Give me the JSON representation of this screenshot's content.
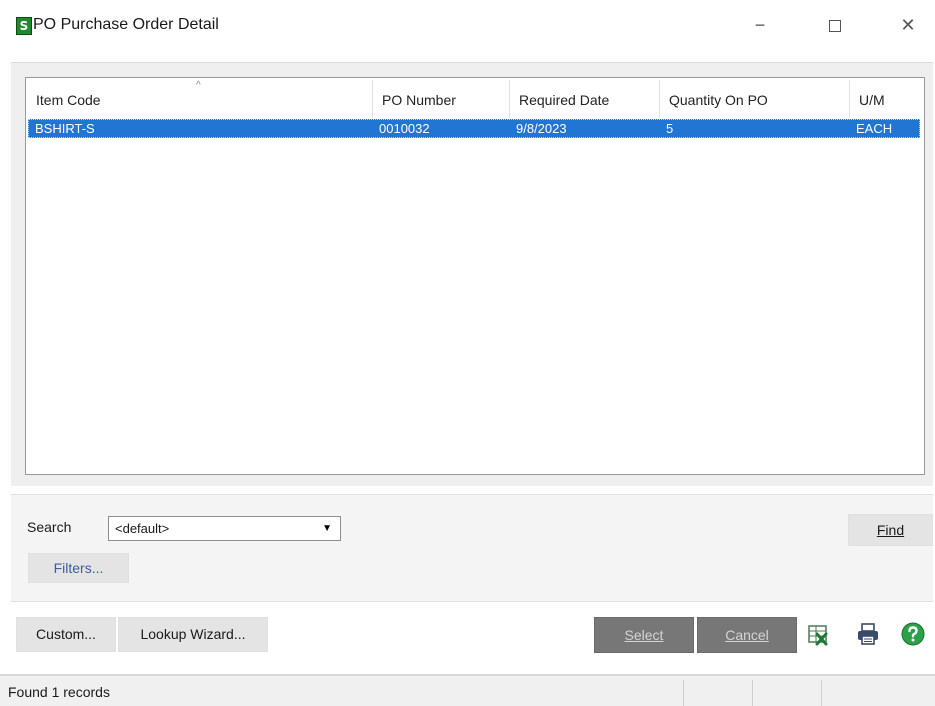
{
  "window": {
    "app_icon_letter": "S",
    "title": "PO Purchase Order Detail",
    "minimize_glyph": "−",
    "close_glyph": "✕"
  },
  "grid": {
    "sort_glyph": "^",
    "columns": [
      "Item Code",
      "PO Number",
      "Required Date",
      "Quantity On PO",
      "U/M"
    ],
    "rows": [
      [
        "BSHIRT-S",
        "0010032",
        "9/8/2023",
        "5",
        "EACH"
      ]
    ]
  },
  "search": {
    "label": "Search",
    "selected": "<default>",
    "find_label": "Find",
    "filters_label": "Filters..."
  },
  "toolbar": {
    "custom_label": "Custom...",
    "wizard_label": "Lookup Wizard...",
    "select_label": "Select",
    "cancel_label": "Cancel",
    "icons": [
      "excel-export-icon",
      "printer-icon",
      "help-icon"
    ]
  },
  "status": {
    "text": "Found 1 records"
  },
  "colors": {
    "selection": "#2076d2",
    "disabled_button": "#777777",
    "app_icon": "#1e8a2b",
    "help": "#2da04a"
  }
}
